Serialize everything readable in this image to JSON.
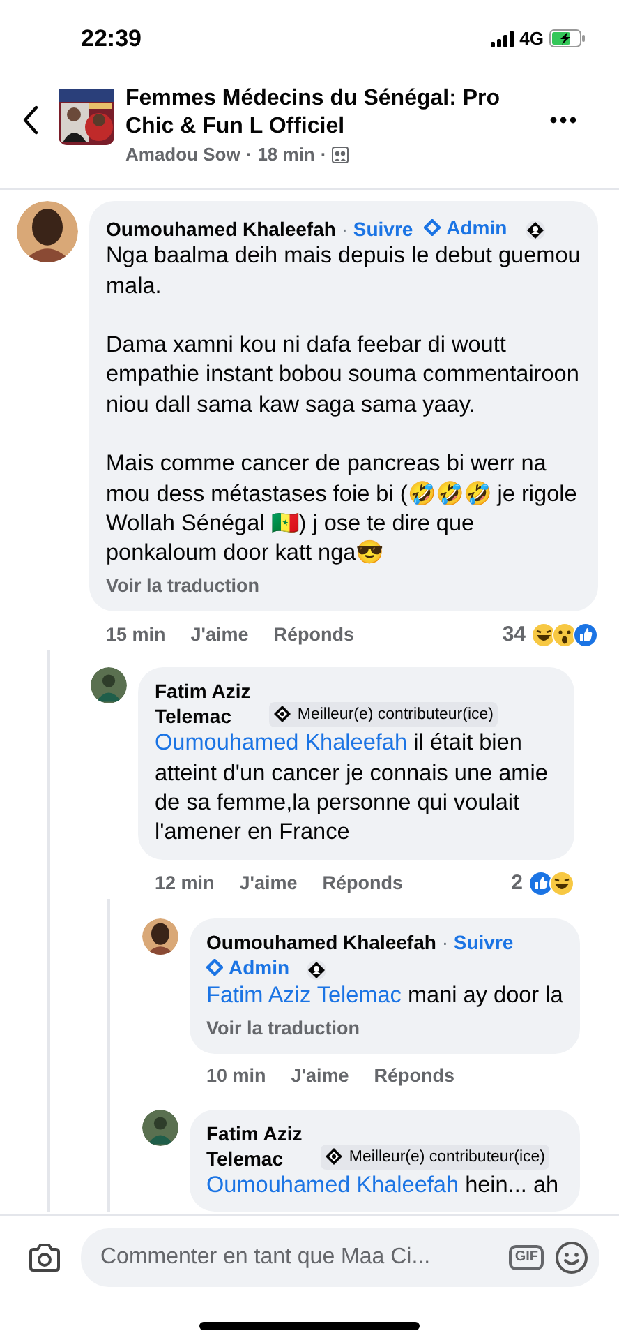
{
  "status_bar": {
    "time": "22:39",
    "network": "4G"
  },
  "header": {
    "title": "Femmes Médecins du Sénégal: Pro Chic & Fun L Officiel",
    "author": "Amadou Sow",
    "separator": "·",
    "time": "18 min"
  },
  "comments": [
    {
      "author": "Oumouhamed Khaleefah",
      "separator": "·",
      "follow": "Suivre",
      "badge": {
        "kind": "admin",
        "label": "Admin"
      },
      "profile_icon": true,
      "paragraphs": [
        "Nga baalma deih mais depuis le debut guemou mala.",
        "Dama xamni kou ni dafa  feebar  di woutt empathie instant bobou souma commentairoon niou dall sama kaw saga sama yaay.",
        "Mais comme cancer de pancreas bi werr na mou dess métastases foie bi (🤣🤣🤣 je rigole Wollah Sénégal 🇸🇳)  j ose te dire que ponkaloum door katt nga😎"
      ],
      "translate": "Voir la traduction",
      "time": "15 min",
      "like": "J'aime",
      "reply": "Réponds",
      "reaction_count": "34",
      "reactions": [
        {
          "kind": "haha"
        },
        {
          "kind": "wow"
        },
        {
          "kind": "like"
        }
      ],
      "replies": [
        {
          "author": "Fatim Aziz Telemac",
          "badge": {
            "kind": "contributor",
            "label": "Meilleur(e) contributeur(ice)"
          },
          "profile_icon": false,
          "mention": "Oumouhamed Khaleefah",
          "paragraphs": [
            "il était bien atteint d'un cancer je connais une amie de sa femme,la personne  qui voulait l'amener en France"
          ],
          "time": "12 min",
          "like": "J'aime",
          "reply": "Réponds",
          "reaction_count": "2",
          "reactions": [
            {
              "kind": "like"
            },
            {
              "kind": "haha"
            }
          ],
          "replies": [
            {
              "author": "Oumouhamed Khaleefah",
              "separator": "·",
              "follow": "Suivre",
              "badge": {
                "kind": "admin",
                "label": "Admin"
              },
              "profile_icon": true,
              "mention": "Fatim Aziz Telemac",
              "paragraphs": [
                "mani ay door la"
              ],
              "translate": "Voir la traduction",
              "time": "10 min",
              "like": "J'aime",
              "reply": "Réponds"
            },
            {
              "author": "Fatim Aziz Telemac",
              "badge": {
                "kind": "contributor",
                "label": "Meilleur(e) contributeur(ice)"
              },
              "profile_icon": false,
              "mention": "Oumouhamed Khaleefah",
              "paragraphs": [
                "hein... ah"
              ]
            }
          ]
        }
      ]
    }
  ],
  "composer": {
    "placeholder": "Commenter en tant que Maa Ci...",
    "gif": "GIF"
  }
}
